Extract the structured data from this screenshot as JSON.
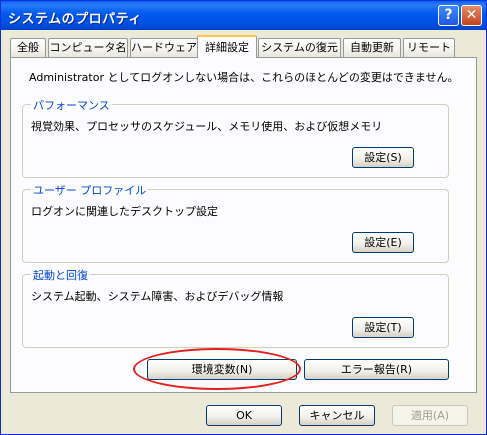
{
  "window": {
    "title": "システムのプロパティ",
    "help_label": "?",
    "close_label": "✕"
  },
  "tabs": [
    {
      "label": "全般"
    },
    {
      "label": "コンピュータ名"
    },
    {
      "label": "ハードウェア"
    },
    {
      "label": "詳細設定",
      "active": true
    },
    {
      "label": "システムの復元"
    },
    {
      "label": "自動更新"
    },
    {
      "label": "リモート"
    }
  ],
  "panel": {
    "notice": "Administrator としてログオンしない場合は、これらのほとんどの変更はできません。",
    "groups": [
      {
        "title": "パフォーマンス",
        "description": "視覚効果、プロセッサのスケジュール、メモリ使用、および仮想メモリ",
        "button": "設定(S)"
      },
      {
        "title": "ユーザー プロファイル",
        "description": "ログオンに関連したデスクトップ設定",
        "button": "設定(E)"
      },
      {
        "title": "起動と回復",
        "description": "システム起動、システム障害、およびデバッグ情報",
        "button": "設定(T)"
      }
    ],
    "env_button": "環境変数(N)",
    "error_button": "エラー報告(R)"
  },
  "footer": {
    "ok": "OK",
    "cancel": "キャンセル",
    "apply": "適用(A)"
  },
  "colors": {
    "titlebar": "#0058ee",
    "annotation_circle": "#e3201c",
    "group_title": "#0046d5"
  }
}
